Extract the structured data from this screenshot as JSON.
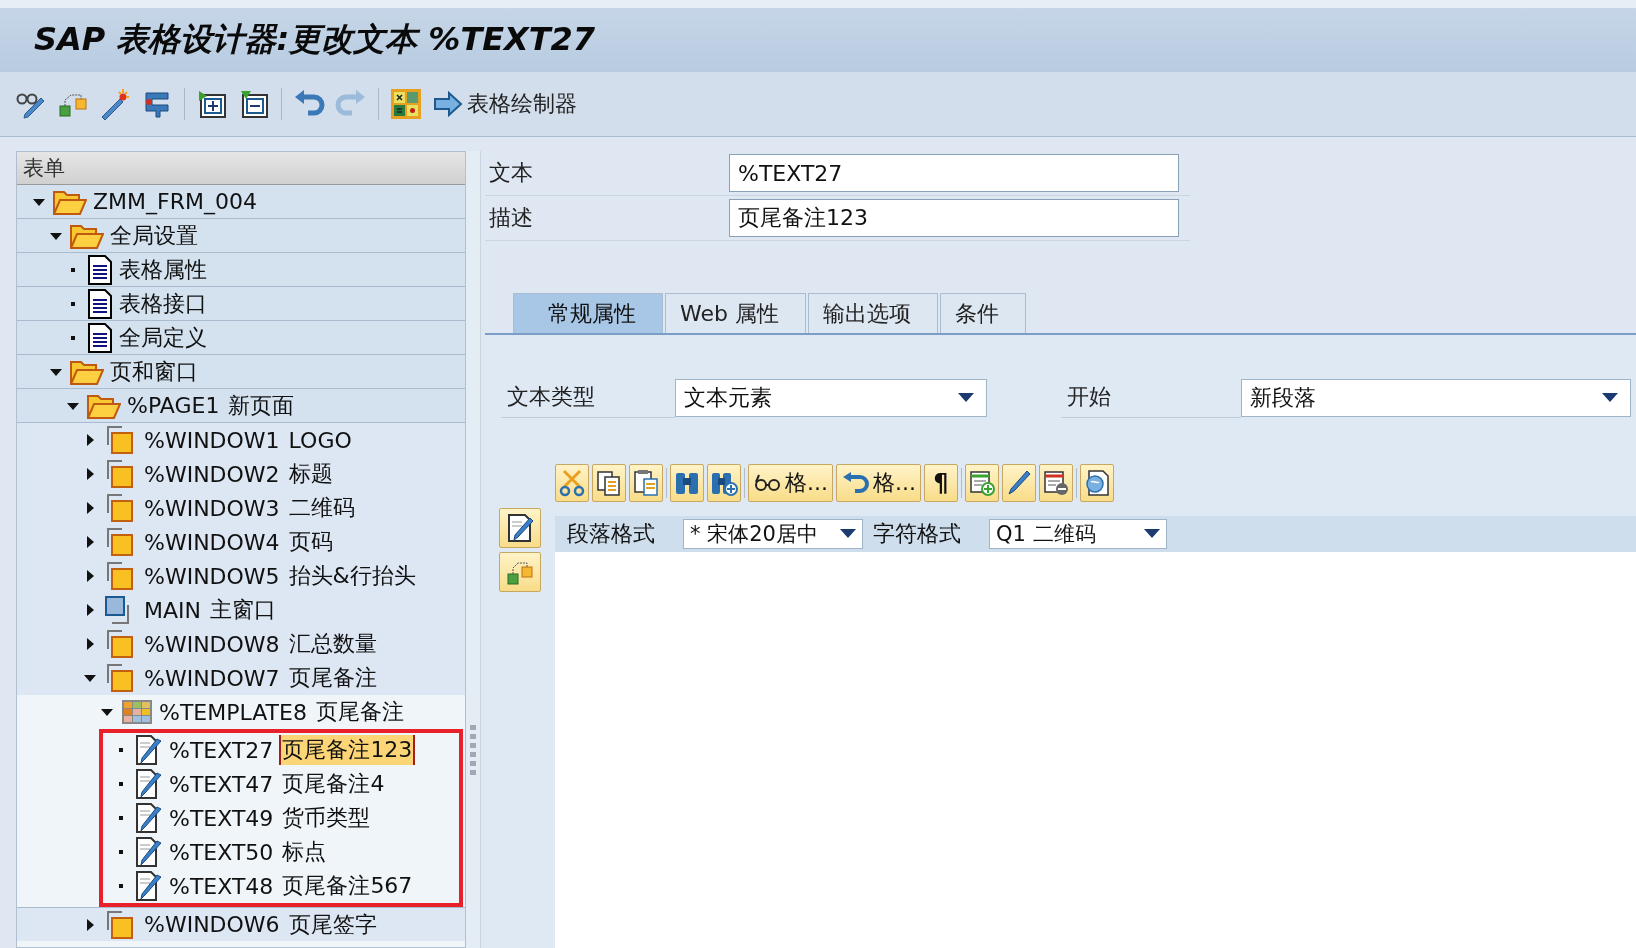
{
  "window": {
    "title": "SAP 表格设计器:更改文本 %TEXT27"
  },
  "toolbar": {
    "redo": {
      "disabled": true
    },
    "link": "表格绘制器"
  },
  "tree": {
    "header": "表单",
    "nodes": [
      {
        "kind": "folder",
        "name": "ZMM_FRM_004",
        "expanded": true,
        "children": [
          {
            "kind": "folder",
            "name": "全局设置",
            "expanded": true,
            "children": [
              {
                "kind": "doc",
                "name": "表格属性"
              },
              {
                "kind": "doc",
                "name": "表格接口"
              },
              {
                "kind": "doc",
                "name": "全局定义"
              }
            ]
          },
          {
            "kind": "folder",
            "name": "页和窗口",
            "expanded": true,
            "children": [
              {
                "kind": "folder",
                "name": "%PAGE1",
                "description": "新页面",
                "expanded": true,
                "children": [
                  {
                    "kind": "window",
                    "name": "%WINDOW1",
                    "description": "LOGO",
                    "expanded": false
                  },
                  {
                    "kind": "window",
                    "name": "%WINDOW2",
                    "description": "标题",
                    "expanded": false
                  },
                  {
                    "kind": "window",
                    "name": "%WINDOW3",
                    "description": "二维码",
                    "expanded": false
                  },
                  {
                    "kind": "window",
                    "name": "%WINDOW4",
                    "description": "页码",
                    "expanded": false
                  },
                  {
                    "kind": "window",
                    "name": "%WINDOW5",
                    "description": "抬头&行抬头",
                    "expanded": false
                  },
                  {
                    "kind": "main",
                    "name": "MAIN",
                    "description": "主窗口",
                    "expanded": false
                  },
                  {
                    "kind": "window",
                    "name": "%WINDOW8",
                    "description": "汇总数量",
                    "expanded": false
                  },
                  {
                    "kind": "window",
                    "name": "%WINDOW7",
                    "description": "页尾备注",
                    "expanded": true,
                    "children": [
                      {
                        "kind": "template",
                        "name": "%TEMPLATE8",
                        "description": "页尾备注",
                        "expanded": true,
                        "framed": true,
                        "children": [
                          {
                            "kind": "text",
                            "name": "%TEXT27",
                            "description": "页尾备注123",
                            "selected": true
                          },
                          {
                            "kind": "text",
                            "name": "%TEXT47",
                            "description": "页尾备注4",
                            "selected": false
                          },
                          {
                            "kind": "text",
                            "name": "%TEXT49",
                            "description": "货币类型",
                            "selected": false
                          },
                          {
                            "kind": "text",
                            "name": "%TEXT50",
                            "description": "标点",
                            "selected": false
                          },
                          {
                            "kind": "text",
                            "name": "%TEXT48",
                            "description": "页尾备注567",
                            "selected": false
                          }
                        ]
                      }
                    ]
                  },
                  {
                    "kind": "window",
                    "name": "%WINDOW6",
                    "description": "页尾签字",
                    "expanded": false
                  }
                ]
              }
            ]
          }
        ]
      }
    ]
  },
  "header_fields": [
    {
      "label": "文本",
      "value": "%TEXT27"
    },
    {
      "label": "描述",
      "value": "页尾备注123"
    }
  ],
  "tabs": [
    {
      "label": "常规属性",
      "selected": true
    },
    {
      "label": "Web 属性",
      "selected": false
    },
    {
      "label": "输出选项",
      "selected": false
    },
    {
      "label": "条件",
      "selected": false
    }
  ],
  "dropdowns": [
    {
      "label": "文本类型",
      "value": "文本元素"
    },
    {
      "label": "开始",
      "value": "新段落"
    }
  ],
  "editor_toolbar": {
    "format_buttons": [
      "格...",
      "格..."
    ],
    "paragraph_mark": "¶"
  },
  "format_bar": [
    {
      "label": "段落格式",
      "value": "* 宋体20居中"
    },
    {
      "label": "字符格式",
      "value": "Q1 二维码"
    }
  ]
}
